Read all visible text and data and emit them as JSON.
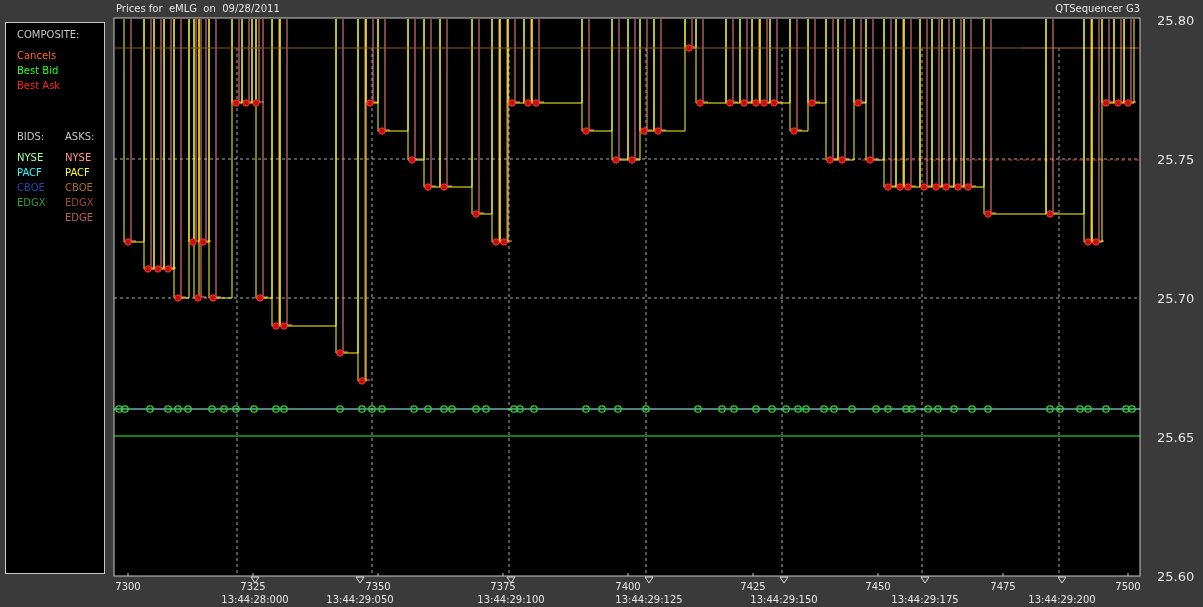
{
  "legend": {
    "composite_title": "COMPOSITE:",
    "composite_items": [
      {
        "label": "Cancels",
        "color": "#ff6a1a"
      },
      {
        "label": "Best Bid",
        "color": "#22ff22"
      },
      {
        "label": "Best Ask",
        "color": "#ff2020"
      }
    ],
    "bids_title": "BIDS:",
    "asks_title": "ASKS:",
    "bids": [
      {
        "label": "NYSE",
        "color": "#a0ffa0"
      },
      {
        "label": "PACF",
        "color": "#20ffff"
      },
      {
        "label": "CBOE",
        "color": "#1848b0"
      },
      {
        "label": "EDGX",
        "color": "#30a030"
      }
    ],
    "asks": [
      {
        "label": "NYSE",
        "color": "#ff9090"
      },
      {
        "label": "PACF",
        "color": "#ffff20"
      },
      {
        "label": "CBOE",
        "color": "#b07010"
      },
      {
        "label": "EDGX",
        "color": "#a04840"
      },
      {
        "label": "EDGE",
        "color": "#b86050"
      }
    ]
  },
  "chart": {
    "title": "Prices for  eMLG  on  09/28/2011",
    "app_title": "QTSequencer G3",
    "y_labels": [
      "25.80",
      "25.75",
      "25.70",
      "25.65",
      "25.60"
    ],
    "x_labels": [
      "7300",
      "7325",
      "7350",
      "7375",
      "7400",
      "7425",
      "7450",
      "7475",
      "7500"
    ],
    "time_labels": [
      "13:44:28:000",
      "13:44:29:050",
      "13:44:29:100",
      "13:44:29:125",
      "13:44:29:150",
      "13:44:29:175",
      "13:44:29:200"
    ]
  }
}
